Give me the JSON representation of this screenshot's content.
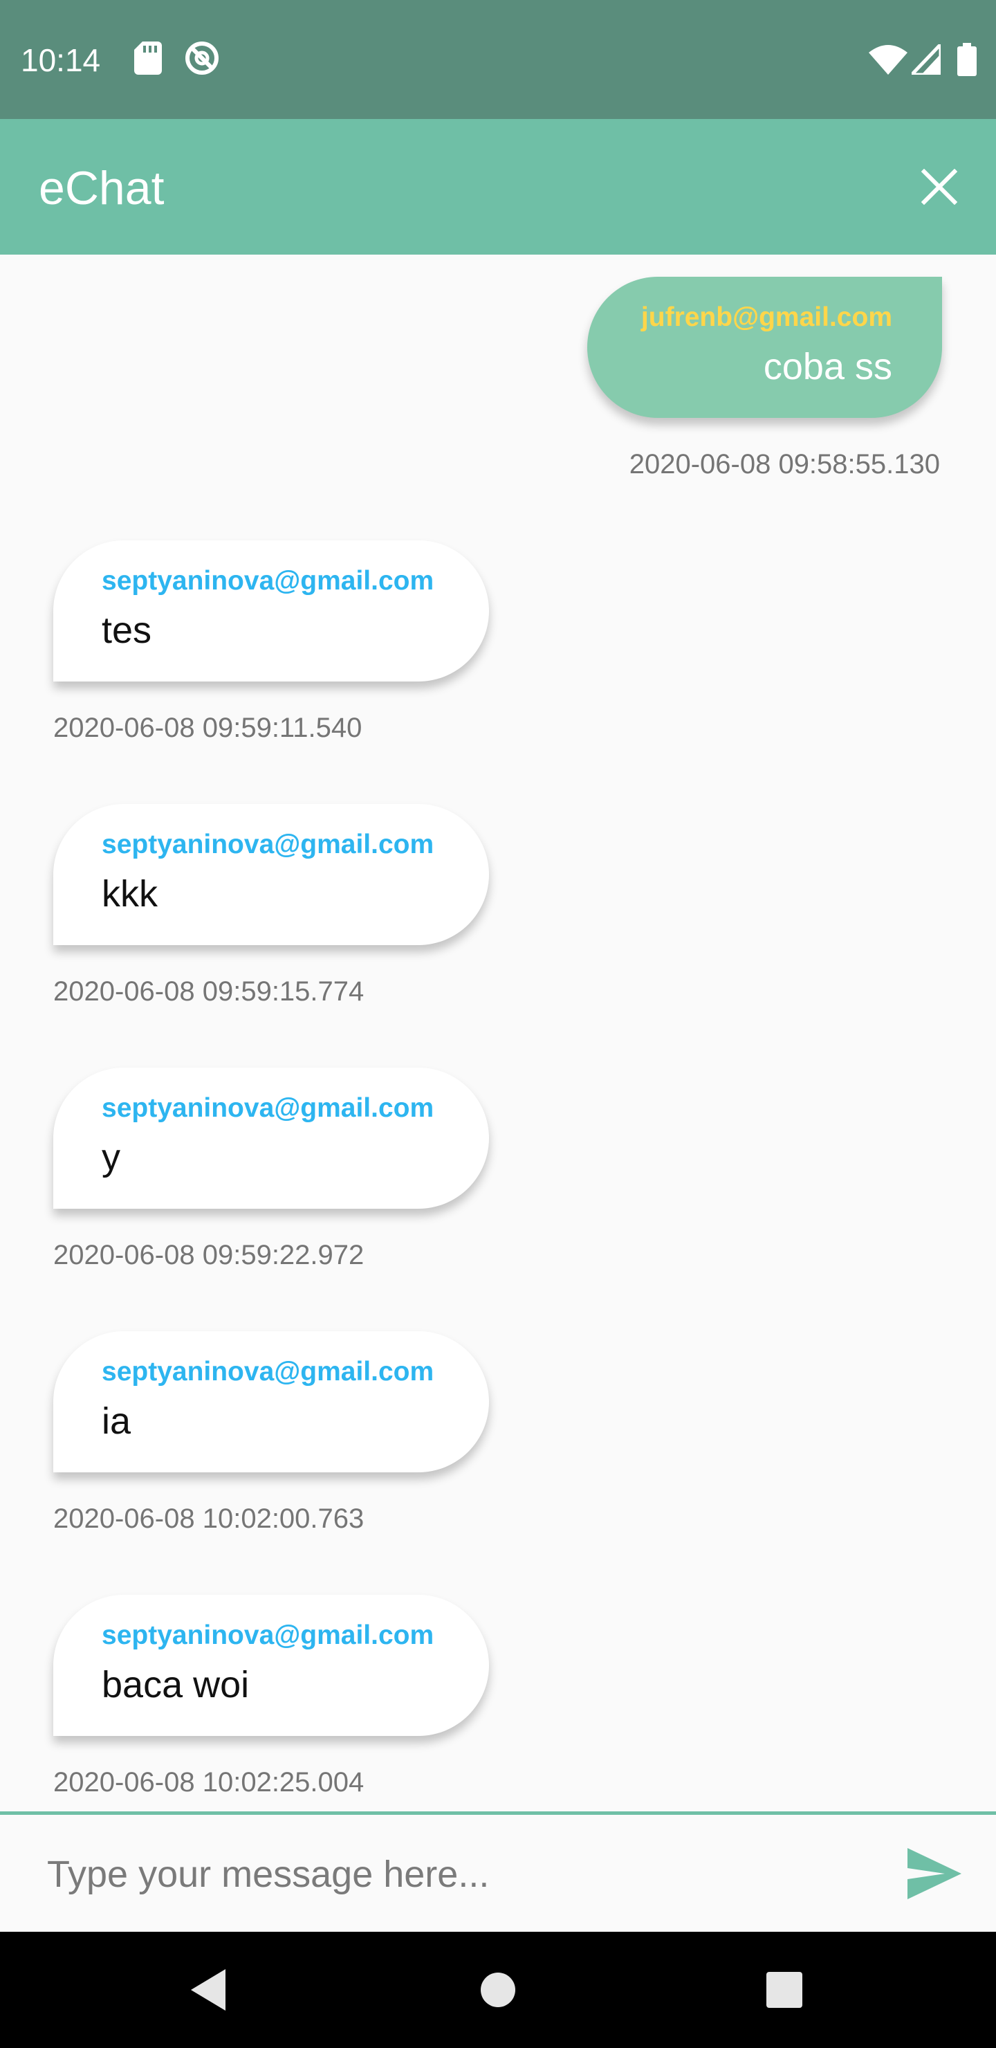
{
  "status_bar": {
    "time": "10:14",
    "icons": [
      "sd-card-icon",
      "sync-off-icon",
      "wifi-icon",
      "signal-icon",
      "battery-icon"
    ]
  },
  "app_bar": {
    "title": "eChat",
    "close_icon": "close-icon"
  },
  "messages": [
    {
      "side": "right",
      "sender": "jufrenb@gmail.com",
      "text": "coba ss",
      "time": "2020-06-08 09:58:55.130"
    },
    {
      "side": "left",
      "sender": "septyaninova@gmail.com",
      "text": "tes",
      "time": "2020-06-08 09:59:11.540"
    },
    {
      "side": "left",
      "sender": "septyaninova@gmail.com",
      "text": "kkk",
      "time": "2020-06-08 09:59:15.774"
    },
    {
      "side": "left",
      "sender": "septyaninova@gmail.com",
      "text": "y",
      "time": "2020-06-08 09:59:22.972"
    },
    {
      "side": "left",
      "sender": "septyaninova@gmail.com",
      "text": "ia",
      "time": "2020-06-08 10:02:00.763"
    },
    {
      "side": "left",
      "sender": "septyaninova@gmail.com",
      "text": "baca woi",
      "time": "2020-06-08 10:02:25.004"
    }
  ],
  "composer": {
    "placeholder": "Type your message here...",
    "value": "",
    "send_icon": "send-icon"
  },
  "nav_bar": {
    "icons": [
      "back-icon",
      "home-icon",
      "recents-icon"
    ]
  },
  "colors": {
    "status_bar": "#5a8d7c",
    "app_bar": "#6fbfa6",
    "own_bubble": "#86cbad",
    "own_sender": "#ffd64a",
    "other_sender": "#2db5f0",
    "accent": "#6fbfa6"
  }
}
